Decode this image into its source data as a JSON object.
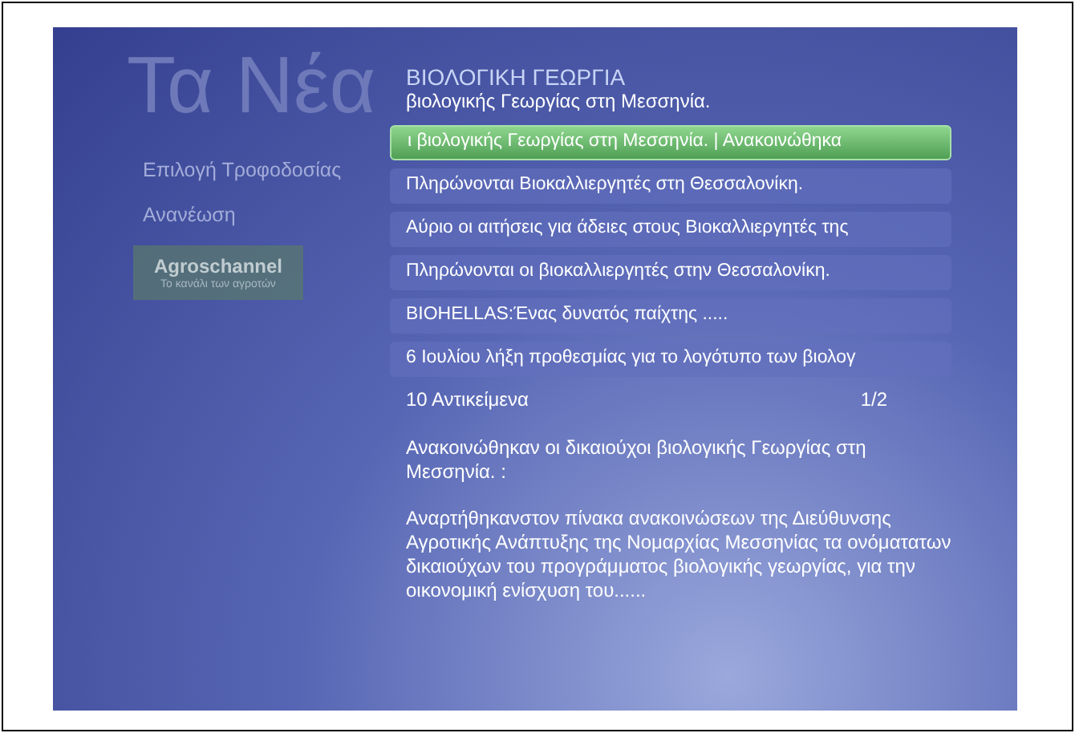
{
  "title": "Τα Νέα",
  "menu": [
    {
      "label": "Επιλογή Τροφοδοσίας"
    },
    {
      "label": "Ανανέωση"
    }
  ],
  "channel_logo": {
    "name": "Agroschannel",
    "tagline": "Το κανάλι των αγροτών"
  },
  "feed": {
    "title": "ΒΙΟΛΟΓΙΚΗ ΓΕΩΡΓΙΑ",
    "subtitle": "βιολογικής Γεωργίας στη Μεσσηνία."
  },
  "items": [
    {
      "label": "ι βιολογικής Γεωργίας στη Μεσσηνία.   |  Ανακοινώθηκα",
      "selected": true
    },
    {
      "label": "Πληρώνονται Βιοκαλλιεργητές στη Θεσσαλονίκη.",
      "selected": false
    },
    {
      "label": "Αύριο οι αιτήσεις για άδειες στους  Βιοκαλλιεργητές της",
      "selected": false
    },
    {
      "label": "Πληρώνονται οι βιοκαλλιεργητές στην Θεσσαλονίκη.",
      "selected": false
    },
    {
      "label": "BIOHELLAS:Ένας δυνατός παίχτης .....",
      "selected": false
    },
    {
      "label": "6 Ιουλίου λήξη προθεσμίας για το λογότυπο των βιολογ",
      "selected": false
    }
  ],
  "item_count": "10 Αντικείμενα",
  "page": "1/2",
  "description": [
    "Ανακοινώθηκαν οι δικαιούχοι βιολογικής Γεωργίας στη Μεσσηνία. :",
    "Αναρτήθηκανστον πίνακα ανακοινώσεων της Διεύθυνσης Αγροτικής Ανάπτυξης της Νομαρχίας Μεσσηνίας τα ονόματατων δικαιούχων του προγράμματος βιολογικής γεωργίας, για την οικονομική ενίσχυση του......"
  ]
}
